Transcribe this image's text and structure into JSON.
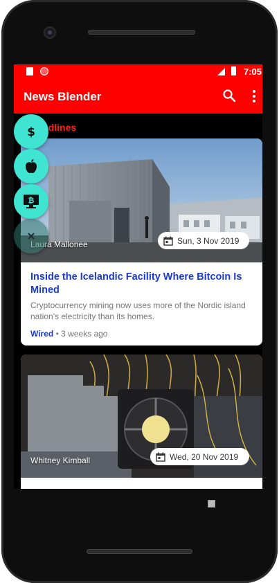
{
  "status_bar": {
    "time": "7:05",
    "icons": [
      "sd-card-icon",
      "record-icon",
      "signal-icon",
      "battery-icon"
    ]
  },
  "app_bar": {
    "title": "News Blender",
    "actions": [
      "search-icon",
      "more-vert-icon"
    ]
  },
  "section": {
    "title": "Headlines",
    "color": "#ff1a1a"
  },
  "fab_menu": {
    "items": [
      {
        "name": "finance",
        "icon": "dollar-icon"
      },
      {
        "name": "apple",
        "icon": "apple-icon"
      },
      {
        "name": "bitcoin",
        "icon": "bitcoin-monitor-icon"
      },
      {
        "name": "close",
        "icon": "close-icon"
      }
    ],
    "color": "#3fe5d0"
  },
  "articles": [
    {
      "author": "Laura Mallonee",
      "date": "Sun, 3 Nov 2019",
      "title": "Inside the Icelandic Facility Where Bitcoin Is Mined",
      "summary": "Cryptocurrency mining now uses more of the Nordic island nation's electricity than its homes.",
      "source": "Wired",
      "age": " • 3 weeks ago"
    },
    {
      "author": "Whitney Kimball",
      "date": "Wed, 20 Nov 2019"
    }
  ],
  "colors": {
    "primary": "#ff0000",
    "link": "#1a3bd1",
    "accent": "#3fe5d0"
  }
}
